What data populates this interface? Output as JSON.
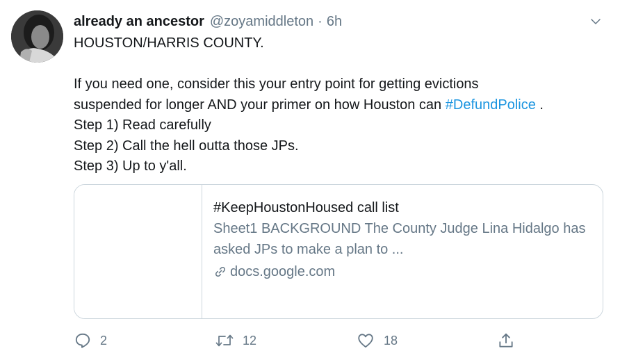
{
  "tweet": {
    "author_name": "already an ancestor",
    "handle": "@zoyamiddleton",
    "separator": "·",
    "time": "6h",
    "text": {
      "line1": "HOUSTON/HARRIS COUNTY.",
      "line2": "If you need one, consider this your entry point for getting evictions",
      "line3_before": "suspended for longer AND your primer on how Houston can ",
      "hashtag": "#DefundPolice",
      "line3_after": " .",
      "line4": "Step 1) Read carefully",
      "line5": "Step 2) Call the hell outta those JPs.",
      "line6": "Step 3) Up to y'all."
    },
    "card": {
      "title": "#KeepHoustonHoused call list",
      "description": "Sheet1 BACKGROUND The County Judge Lina Hidalgo has asked JPs to make a plan to ...",
      "domain": "docs.google.com"
    },
    "actions": {
      "reply_count": "2",
      "retweet_count": "12",
      "like_count": "18"
    }
  },
  "colors": {
    "text": "#14171a",
    "secondary": "#657786",
    "link": "#1b95e0",
    "border": "#ccd6dd"
  },
  "icons": [
    "avatar-photo",
    "chevron-down-icon",
    "link-icon",
    "reply-icon",
    "retweet-icon",
    "like-icon",
    "share-icon"
  ]
}
